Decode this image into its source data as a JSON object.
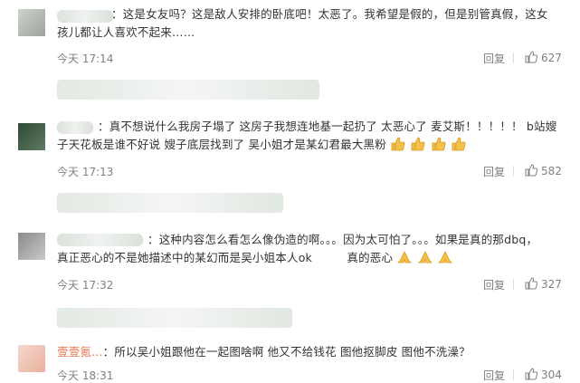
{
  "comments": [
    {
      "text_line1": "：这是女友吗？这是敌人安排的卧底吧！太恶了。我希望是假的，但是别管真假，这女",
      "text_line2": "孩儿都让人喜欢不起来……",
      "time": "今天 17:14",
      "reply": "回复",
      "likes": "627",
      "avatar_icon": "user-avatar"
    },
    {
      "text_line1": "：真不想说什么我房子塌了 这房子我想连地基一起扔了 太恶心了 麦艾斯！！！！！ b站嫂",
      "text_line2": "子天花板是谁不好说 嫂子底层找到了 吴小姐才是某幻君最大黑粉",
      "emoji_count": 4,
      "emoji_icon": "thumbs-up-emoji",
      "time": "今天 17:13",
      "reply": "回复",
      "likes": "582"
    },
    {
      "text_line1": "：这种内容怎么看怎么像伪造的啊。。。因为太可怕了。。。如果是真的那dbq，",
      "text_line2": "真正恶心的不是她描述中的某幻而是吴小姐本人ok",
      "text_line2b": "真的恶心",
      "emoji_count": 3,
      "emoji_icon": "praying-hands-emoji",
      "time": "今天 17:32",
      "reply": "回复",
      "likes": "327"
    },
    {
      "username": "壹壹氪...",
      "text_line1": "：所以吴小姐跟他在一起图啥啊 他又不给钱花 图他抠脚皮 图他不洗澡？",
      "time": "今天 18:31",
      "reply": "回复",
      "likes": "304"
    }
  ],
  "colors": {
    "text": "#333333",
    "meta": "#808080",
    "username": "#eb7350"
  }
}
